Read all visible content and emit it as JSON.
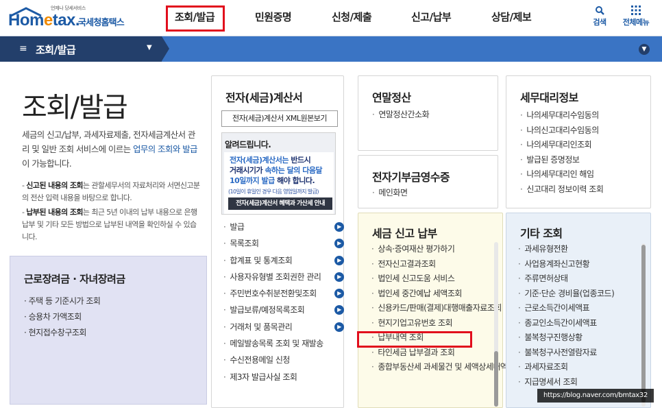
{
  "logo": {
    "brand_part1": "Hom",
    "brand_part2": "e",
    "brand_part3": "tax.",
    "korean": "국세청홈택스",
    "tagline": "언제나 당세서비스"
  },
  "gnb": {
    "items": [
      "조회/발급",
      "민원증명",
      "신청/제출",
      "신고/납부",
      "상담/제보"
    ],
    "active": "조회/발급"
  },
  "utility": {
    "search": "검색",
    "all_menu": "전체메뉴"
  },
  "subbar": {
    "title": "조회/발급"
  },
  "intro": {
    "title": "조회/발급",
    "desc_part1": "세금의 신고/납부, 과세자료제출, 전자세금계산서 관리 및 일반 조회 서비스에 이르는 ",
    "desc_link": "업무의 조회와 발급",
    "desc_part2": "이 가능합니다.",
    "note1_bold": "신고된 내용의 조회",
    "note1_text": "는 관할세무서의 자료처리와 서면신고분의 전산 입력 내용을 바탕으로 합니다.",
    "note2_bold": "납부된 내용의 조회",
    "note2_text": "는 최근 5년 이내의 납부 내용으로 은행 납부 및 기타 모든 방법으로 납부된 내역을 확인하실 수 있습니다."
  },
  "benefit": {
    "title": "근로장려금 · 자녀장려금",
    "items": [
      "주택 등 기준시가 조회",
      "승용차 가액조회",
      "현지접수창구조회"
    ]
  },
  "etax": {
    "title": "전자(세금)계산서",
    "xml_button": "전자(세금)계산서 XML원본보기",
    "notice_head": "알려드립니다.",
    "notice_line1_a": "전자(세금)계산서는",
    "notice_line1_b": " 반드시 ",
    "notice_line2_a": "거래시기가 ",
    "notice_line2_b": "속하는 달의 다음달",
    "notice_line3_a": "10일까지 발급",
    "notice_line3_b": " 해야 합니다.",
    "notice_small": "(10일이 휴일인 경우 다음 영업일까지 발급)",
    "notice_dark": "전자(세금)계산서 혜택과 가산세 안내",
    "links": [
      "발급",
      "목록조회",
      "합계표 및 통계조회",
      "사용자유형별 조회권한 관리",
      "주민번호수취분전환및조회",
      "발급보류/예정목록조회",
      "거래처 및 품목관리",
      "메일발송목록 조회 및 재발송",
      "수신전용메일 신청",
      "제3자 발급사실 조회"
    ],
    "go_flags": [
      true,
      true,
      true,
      true,
      true,
      true,
      true,
      false,
      false,
      false
    ]
  },
  "yearend": {
    "title": "연말정산",
    "items": [
      "연말정산간소화"
    ]
  },
  "donation": {
    "title": "전자기부금영수증",
    "items": [
      "메인화면"
    ]
  },
  "taxreport": {
    "title": "세금 신고 납부",
    "items": [
      "상속·증여재산 평가하기",
      "전자신고결과조회",
      "법인세 신고도움 서비스",
      "법인세 중간예납 세액조회",
      "신용카드/판매(결제)대행매출자료조회",
      "현지기업고유번호 조회",
      "납부내역 조회",
      "타인세금 납부결과 조회",
      "종합부동산세 과세물건 및 세액상세내역 조회"
    ]
  },
  "agent": {
    "title": "세무대리정보",
    "items": [
      "나의세무대리수임동의",
      "나의신고대리수임동의",
      "나의세무대리인조회",
      "발급된 증명정보",
      "나의세무대리인 해임",
      "신고대리 정보이력 조회"
    ]
  },
  "other": {
    "title": "기타 조회",
    "items": [
      "과세유형전환",
      "사업용계좌신고현황",
      "주류면허상태",
      "기준·단순 경비율(업종코드)",
      "근로소득간이세액표",
      "종교인소득간이세액표",
      "불복청구진행상황",
      "불복청구사전열람자료",
      "과세자료조회",
      "지급명세서 조회"
    ]
  },
  "watermark": "https://blog.naver.com/bmtax32",
  "colors": {
    "brand_blue": "#1c5aa5",
    "accent_orange": "#f08a00",
    "highlight_red": "#e10d1c",
    "subbar_dark": "#233f6b",
    "subbar_light": "#3a74c4"
  }
}
